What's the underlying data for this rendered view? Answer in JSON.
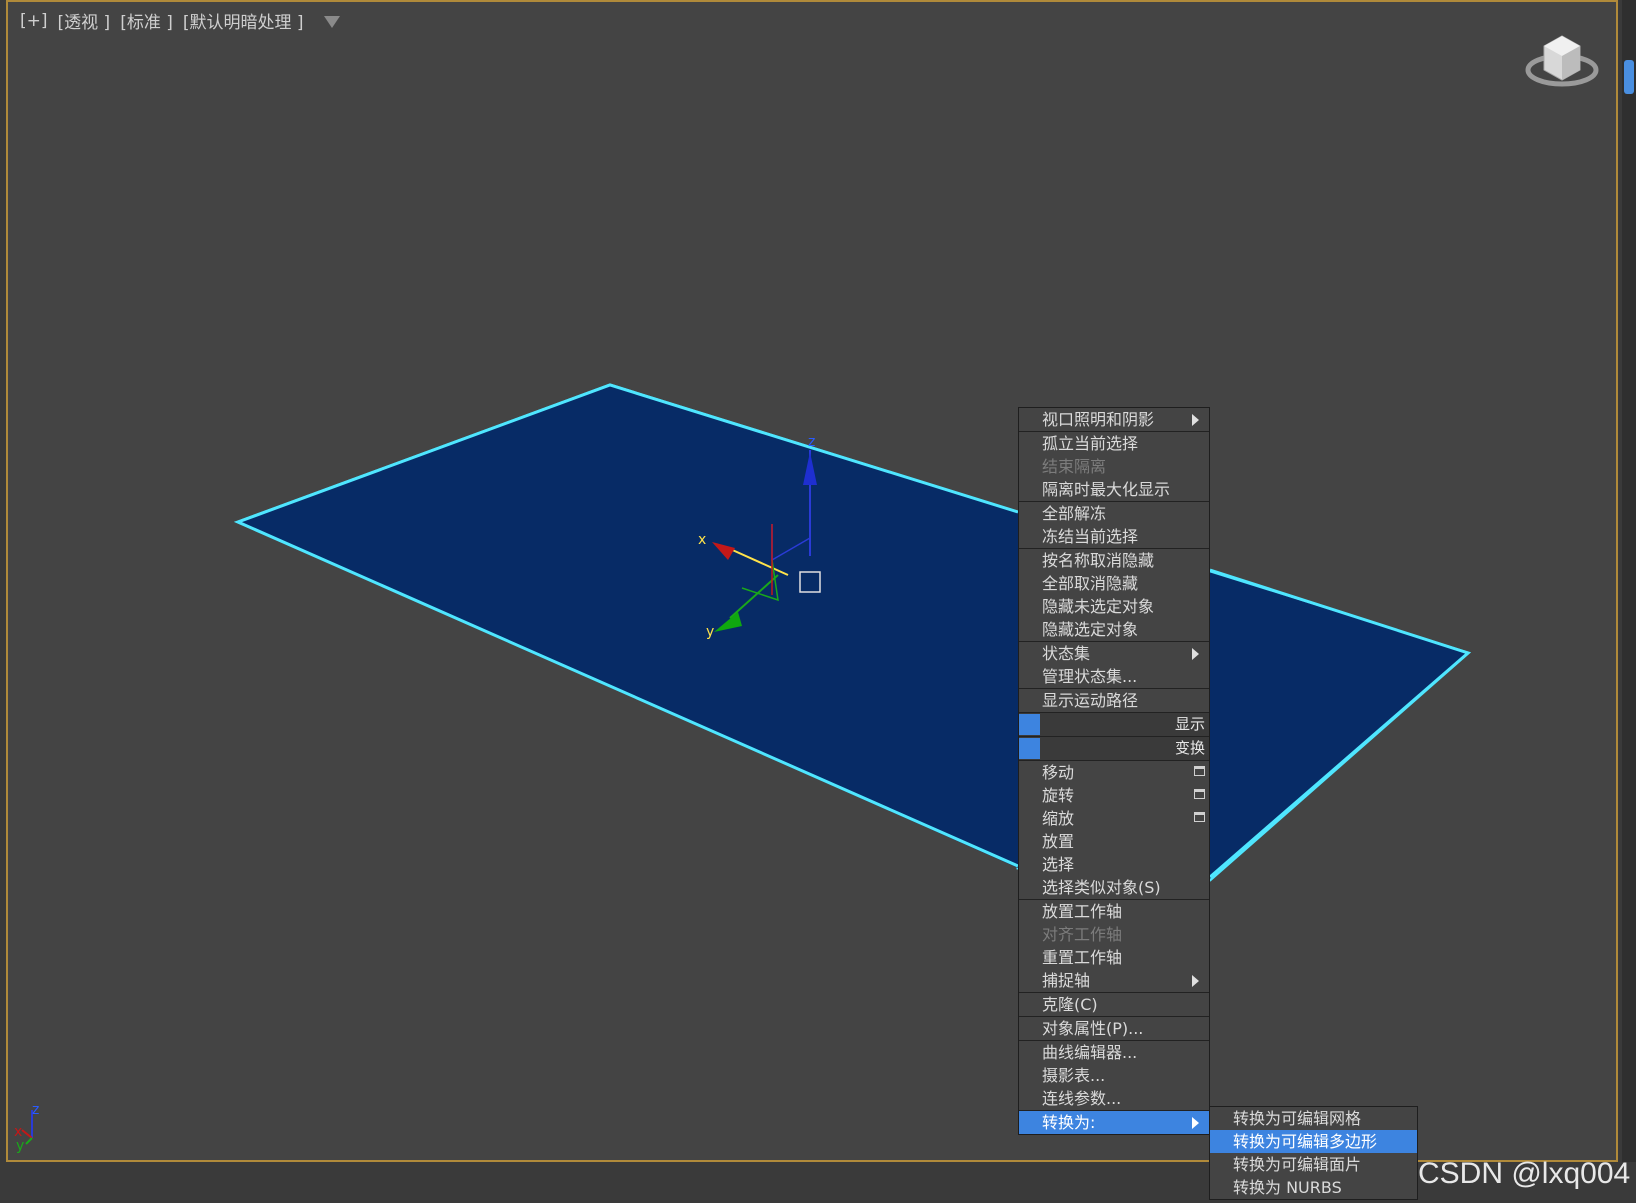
{
  "viewport": {
    "labels": [
      "[+]",
      "[透视 ]",
      "[标准 ]",
      "[默认明暗处理 ]"
    ]
  },
  "gizmo": {
    "x_label": "x",
    "y_label": "y",
    "z_label": "z"
  },
  "axis_tripod": {
    "x_label": "x",
    "y_label": "y",
    "z_label": "z"
  },
  "menu": {
    "items": [
      {
        "label": "视口照明和阴影",
        "has_submenu": true
      },
      {
        "label": "孤立当前选择"
      },
      {
        "label": "结束隔离",
        "disabled": true
      },
      {
        "label": "隔离时最大化显示"
      },
      {
        "label": "全部解冻"
      },
      {
        "label": "冻结当前选择"
      },
      {
        "label": "按名称取消隐藏"
      },
      {
        "label": "全部取消隐藏"
      },
      {
        "label": "隐藏未选定对象"
      },
      {
        "label": "隐藏选定对象"
      },
      {
        "label": "状态集",
        "has_submenu": true
      },
      {
        "label": "管理状态集..."
      },
      {
        "label": "显示运动路径"
      },
      {
        "label": "显示",
        "header": true
      },
      {
        "label": "变换",
        "header": true
      },
      {
        "label": "移动",
        "has_settings": true
      },
      {
        "label": "旋转",
        "has_settings": true
      },
      {
        "label": "缩放",
        "has_settings": true
      },
      {
        "label": "放置"
      },
      {
        "label": "选择"
      },
      {
        "label": "选择类似对象(S)"
      },
      {
        "label": "放置工作轴"
      },
      {
        "label": "对齐工作轴",
        "disabled": true
      },
      {
        "label": "重置工作轴"
      },
      {
        "label": "捕捉轴",
        "has_submenu": true
      },
      {
        "label": "克隆(C)"
      },
      {
        "label": "对象属性(P)..."
      },
      {
        "label": "曲线编辑器..."
      },
      {
        "label": "摄影表..."
      },
      {
        "label": "连线参数..."
      },
      {
        "label": "转换为:",
        "has_submenu": true,
        "active": true
      }
    ]
  },
  "submenu": {
    "items": [
      {
        "label": "转换为可编辑网格"
      },
      {
        "label": "转换为可编辑多边形",
        "active": true
      },
      {
        "label": "转换为可编辑面片"
      },
      {
        "label": "转换为 NURBS"
      }
    ]
  },
  "watermark": "CSDN @lxq004",
  "colors": {
    "plane_fill": "#072b66",
    "plane_edge": "#4fe6ff",
    "menu_highlight": "#3d84e0",
    "viewport_border": "#b08a3a"
  }
}
